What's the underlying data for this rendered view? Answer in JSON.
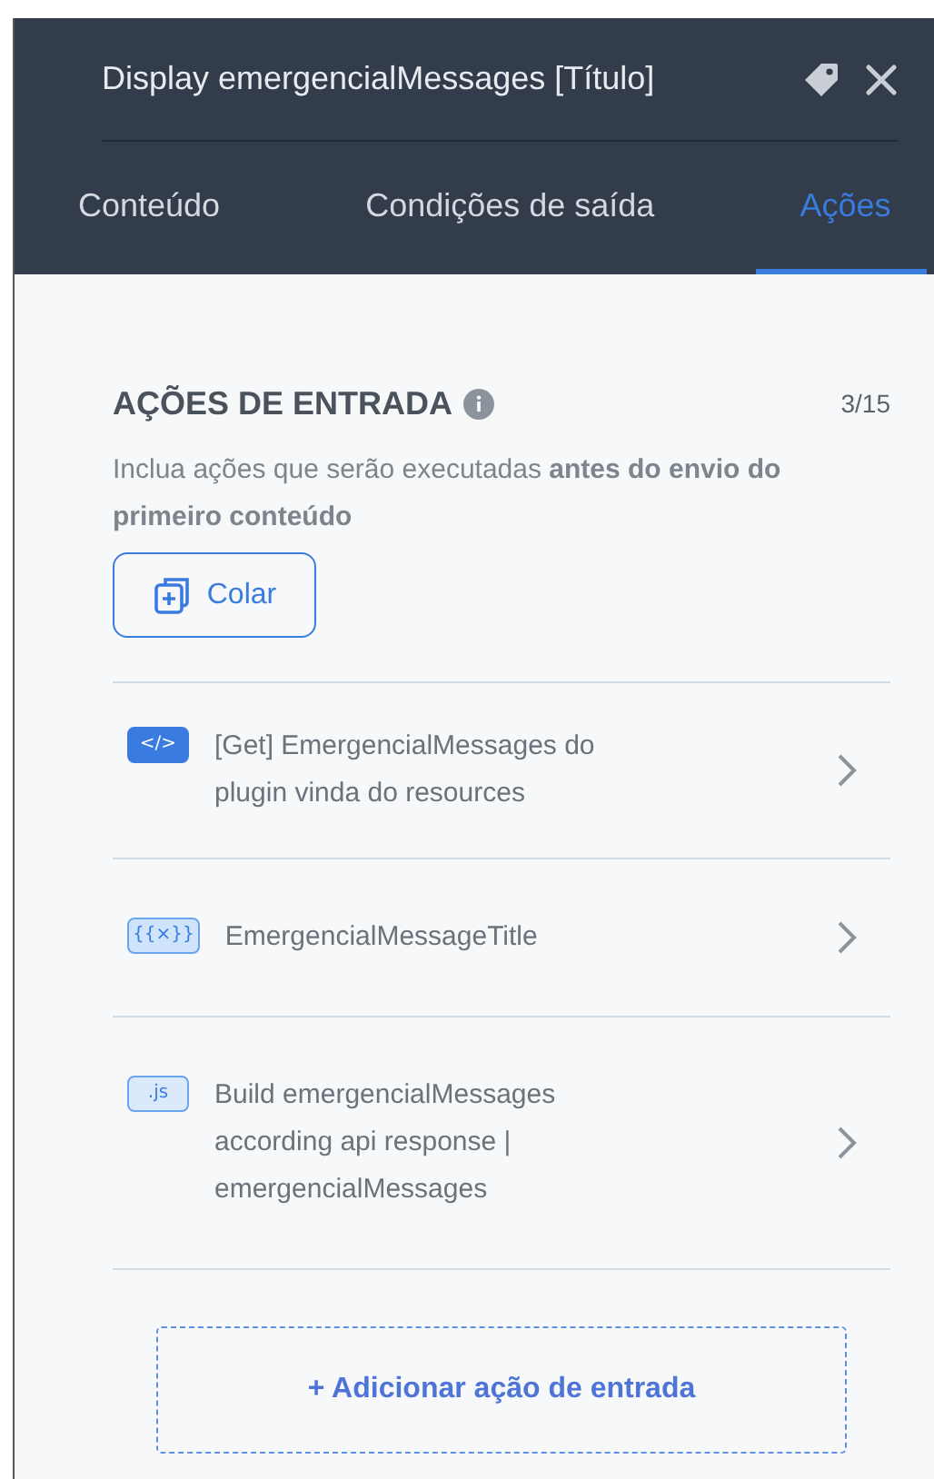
{
  "header": {
    "title": "Display emergencialMessages [Título]"
  },
  "tabs": [
    {
      "label": "Conteúdo",
      "selected": false
    },
    {
      "label": "Condições de saída",
      "selected": false
    },
    {
      "label": "Ações",
      "selected": true
    }
  ],
  "section": {
    "title": "AÇÕES DE ENTRADA",
    "count": "3/15",
    "description": "Inclua ações que serão executadas **antes do envio do primeiro conteúdo**",
    "paste_button": "Colar"
  },
  "actions": [
    {
      "kind": "request",
      "badge": "</>",
      "label": "[Get] EmergencialMessages do plugin vinda do resources"
    },
    {
      "kind": "variable",
      "badge": "{{×}}",
      "label": "EmergencialMessageTitle"
    },
    {
      "kind": "script",
      "badge": ".js",
      "label": "Build emergencialMessages according api response | emergencialMessages"
    }
  ],
  "add_button": "+ Adicionar ação de entrada"
}
